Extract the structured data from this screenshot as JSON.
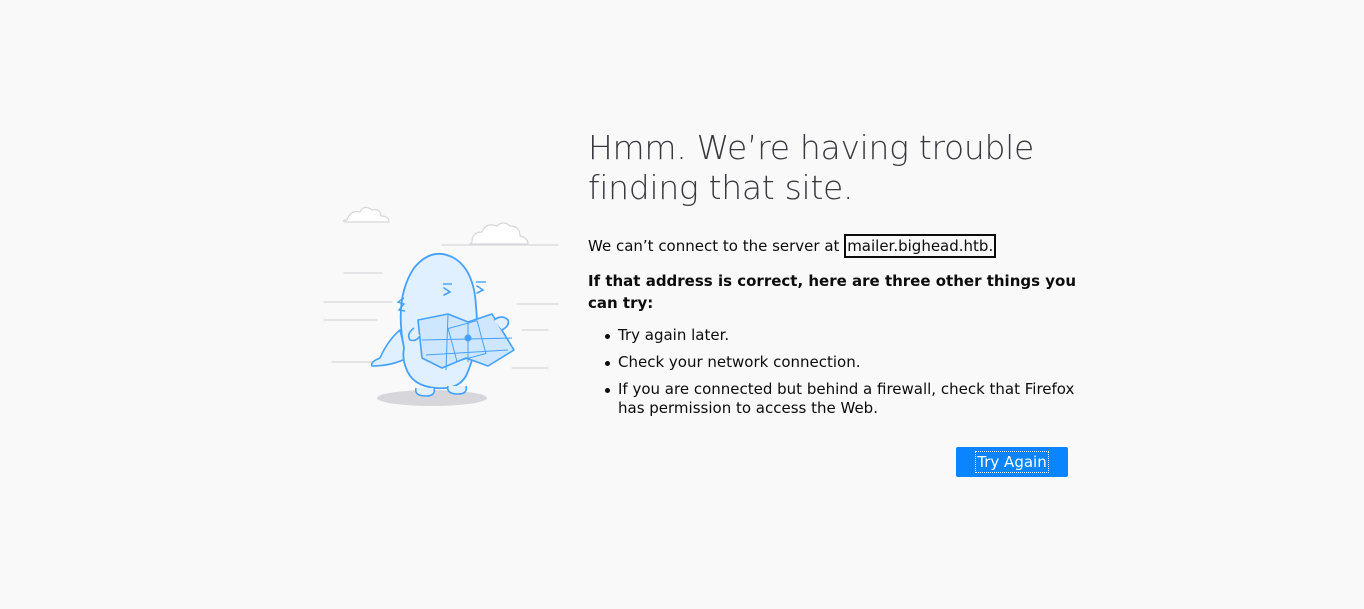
{
  "error_page": {
    "title": "Hmm. We’re having trouble finding that site.",
    "description_prefix": "We can’t connect to the server at ",
    "host": "mailer.bighead.htb.",
    "suggestions_title": "If that address is correct, here are three other things you can try:",
    "suggestions": [
      "Try again later.",
      "Check your network connection.",
      "If you are connected but behind a firewall, check that Firefox has permission to access the Web."
    ],
    "try_again_label": "Try Again"
  },
  "colors": {
    "background": "#f9f9fa",
    "accent": "#0a84ff",
    "illustration": "#45a1ff"
  },
  "icons": {
    "illustration": "lost-dino-with-map-illustration"
  }
}
